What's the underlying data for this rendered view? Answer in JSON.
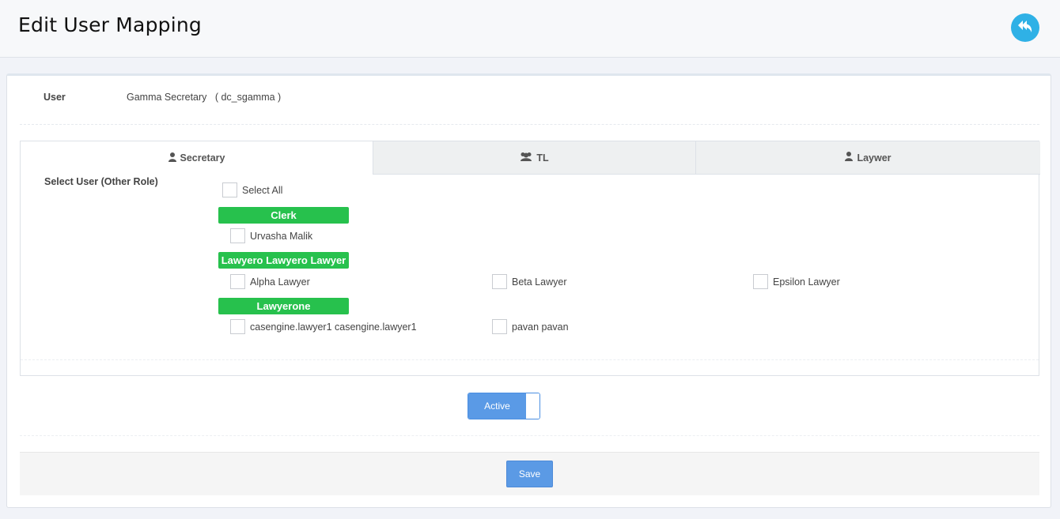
{
  "header": {
    "title": "Edit User Mapping",
    "back_icon": "reply-icon",
    "accent_color": "#2fb1e6"
  },
  "user": {
    "label": "User",
    "value": "Gamma Secretary   ( dc_sgamma )"
  },
  "tabs": [
    {
      "label": "Secretary",
      "icon": "user-icon",
      "active": true
    },
    {
      "label": "TL",
      "icon": "users-icon",
      "active": false
    },
    {
      "label": "Laywer",
      "icon": "user-icon",
      "active": false
    }
  ],
  "select_user_label": "Select User (Other Role)",
  "select_all_label": "Select All",
  "groups": [
    {
      "name": "Clerk",
      "users": [
        "Urvasha Malik"
      ]
    },
    {
      "name": "Lawyero Lawyero Lawyer",
      "users": [
        "Alpha Lawyer",
        "Beta Lawyer",
        "Epsilon Lawyer"
      ]
    },
    {
      "name": "Lawyerone",
      "users": [
        "casengine.lawyer1 casengine.lawyer1",
        "pavan pavan"
      ]
    }
  ],
  "status_toggle": {
    "label": "Active",
    "on": true
  },
  "save_label": "Save",
  "colors": {
    "group_badge": "#27c14d",
    "button": "#5b9ae5"
  }
}
